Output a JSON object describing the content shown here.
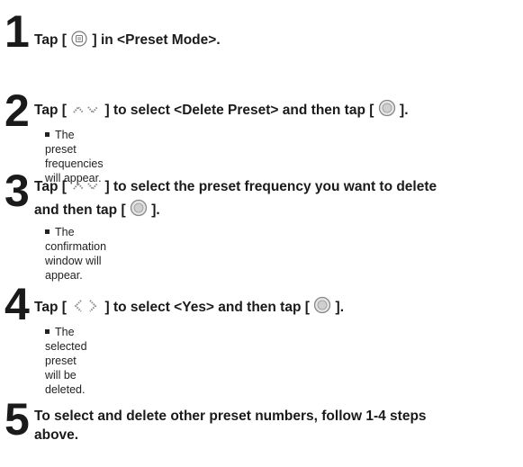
{
  "steps": [
    {
      "number": "1",
      "line1_a": "Tap [",
      "line1_b": "] in <Preset Mode>.",
      "icon": "menu-icon"
    },
    {
      "number": "2",
      "line1_a": "Tap [",
      "line1_b": "] to select <Delete Preset> and then tap [",
      "line1_c": "].",
      "icon": "up-down-icon",
      "note": "The preset frequencies will appear."
    },
    {
      "number": "3",
      "line1_a": "Tap [",
      "line1_b": "] to select the preset frequency you want to delete",
      "line2_a": "and then tap [",
      "line2_b": "].",
      "icon": "up-down-icon",
      "note": "The confirmation window will appear."
    },
    {
      "number": "4",
      "line1_a": "Tap [",
      "line1_b": "] to select <Yes> and then tap [",
      "line1_c": "].",
      "icon": "left-right-icon",
      "note": "The selected preset will be deleted."
    },
    {
      "number": "5",
      "line1": "To select and delete other preset numbers, follow 1-4 steps",
      "line2": "above."
    }
  ]
}
